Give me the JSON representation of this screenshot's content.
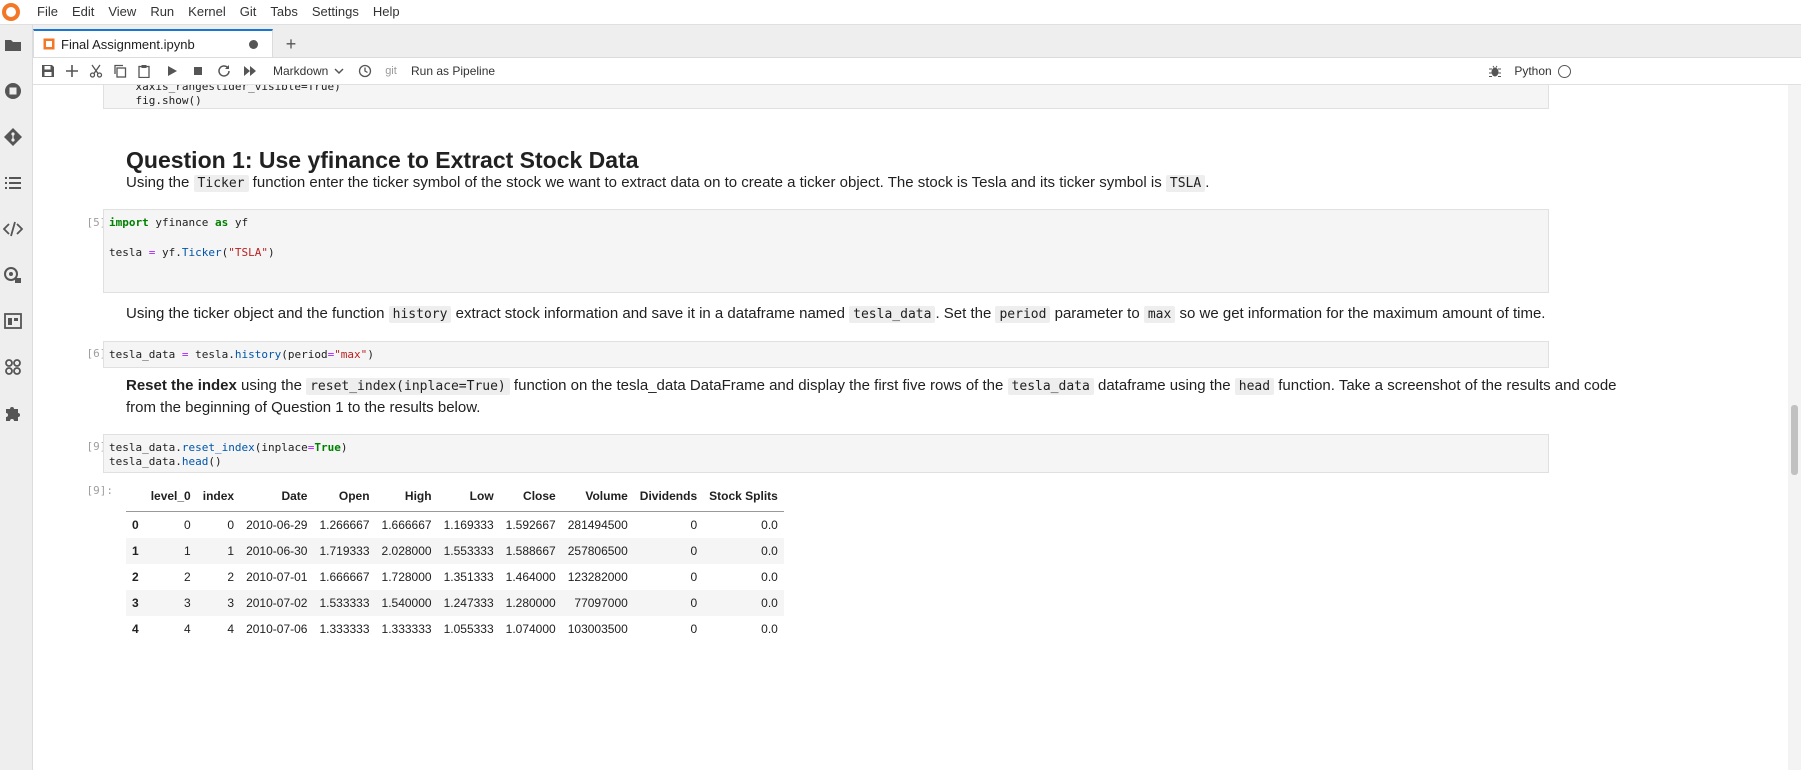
{
  "menu": [
    "File",
    "Edit",
    "View",
    "Run",
    "Kernel",
    "Git",
    "Tabs",
    "Settings",
    "Help"
  ],
  "tab": {
    "title": "Final Assignment.ipynb",
    "new_tab": "+"
  },
  "toolbar": {
    "cell_type": "Markdown",
    "git": "git",
    "pipeline": "Run as Pipeline",
    "kernel": "Python"
  },
  "cells": {
    "top_code": [
      "    xaxis_rangeslider_visible=True)",
      "    fig.show()"
    ],
    "heading": "Question 1: Use yfinance to Extract Stock Data",
    "p1": {
      "t1": "Using the ",
      "c1": "Ticker",
      "t2": " function enter the ticker symbol of the stock we want to extract data on to create a ticker object. The stock is Tesla and its ticker symbol is ",
      "c2": "TSLA",
      "t3": "."
    },
    "cell5": {
      "prompt": "[5]:",
      "line1": "import yfinance as yf",
      "line2": "tesla = yf.Ticker(\"TSLA\")"
    },
    "p2": {
      "t1": "Using the ticker object and the function ",
      "c1": "history",
      "t2": " extract stock information and save it in a dataframe named ",
      "c2": "tesla_data",
      "t3": ". Set the ",
      "c3": "period",
      "t4": " parameter to ",
      "c4": "max",
      "t5": " so we get information for the maximum amount of time."
    },
    "cell6": {
      "prompt": "[6]:",
      "line1": "tesla_data = tesla.history(period=\"max\")"
    },
    "p3": {
      "b1": "Reset the index",
      "t1": " using the ",
      "c1": "reset_index(inplace=True)",
      "t2": " function on the tesla_data DataFrame and display the first five rows of the ",
      "c2": "tesla_data",
      "t3": " dataframe using the ",
      "c3": "head",
      "t4": " function. Take a screenshot of the results and code",
      "line2": "from the beginning of Question 1 to the results below."
    },
    "cell9": {
      "prompt": "[9]:",
      "line1": "tesla_data.reset_index(inplace=True)",
      "line2": "tesla_data.head()",
      "out_prompt": "[9]:"
    }
  },
  "dataframe": {
    "columns": [
      "",
      "level_0",
      "index",
      "Date",
      "Open",
      "High",
      "Low",
      "Close",
      "Volume",
      "Dividends",
      "Stock Splits"
    ],
    "rows": [
      [
        "0",
        "0",
        "0",
        "2010-06-29",
        "1.266667",
        "1.666667",
        "1.169333",
        "1.592667",
        "281494500",
        "0",
        "0.0"
      ],
      [
        "1",
        "1",
        "1",
        "2010-06-30",
        "1.719333",
        "2.028000",
        "1.553333",
        "1.588667",
        "257806500",
        "0",
        "0.0"
      ],
      [
        "2",
        "2",
        "2",
        "2010-07-01",
        "1.666667",
        "1.728000",
        "1.351333",
        "1.464000",
        "123282000",
        "0",
        "0.0"
      ],
      [
        "3",
        "3",
        "3",
        "2010-07-02",
        "1.533333",
        "1.540000",
        "1.247333",
        "1.280000",
        "77097000",
        "0",
        "0.0"
      ],
      [
        "4",
        "4",
        "4",
        "2010-07-06",
        "1.333333",
        "1.333333",
        "1.055333",
        "1.074000",
        "103003500",
        "0",
        "0.0"
      ]
    ]
  }
}
